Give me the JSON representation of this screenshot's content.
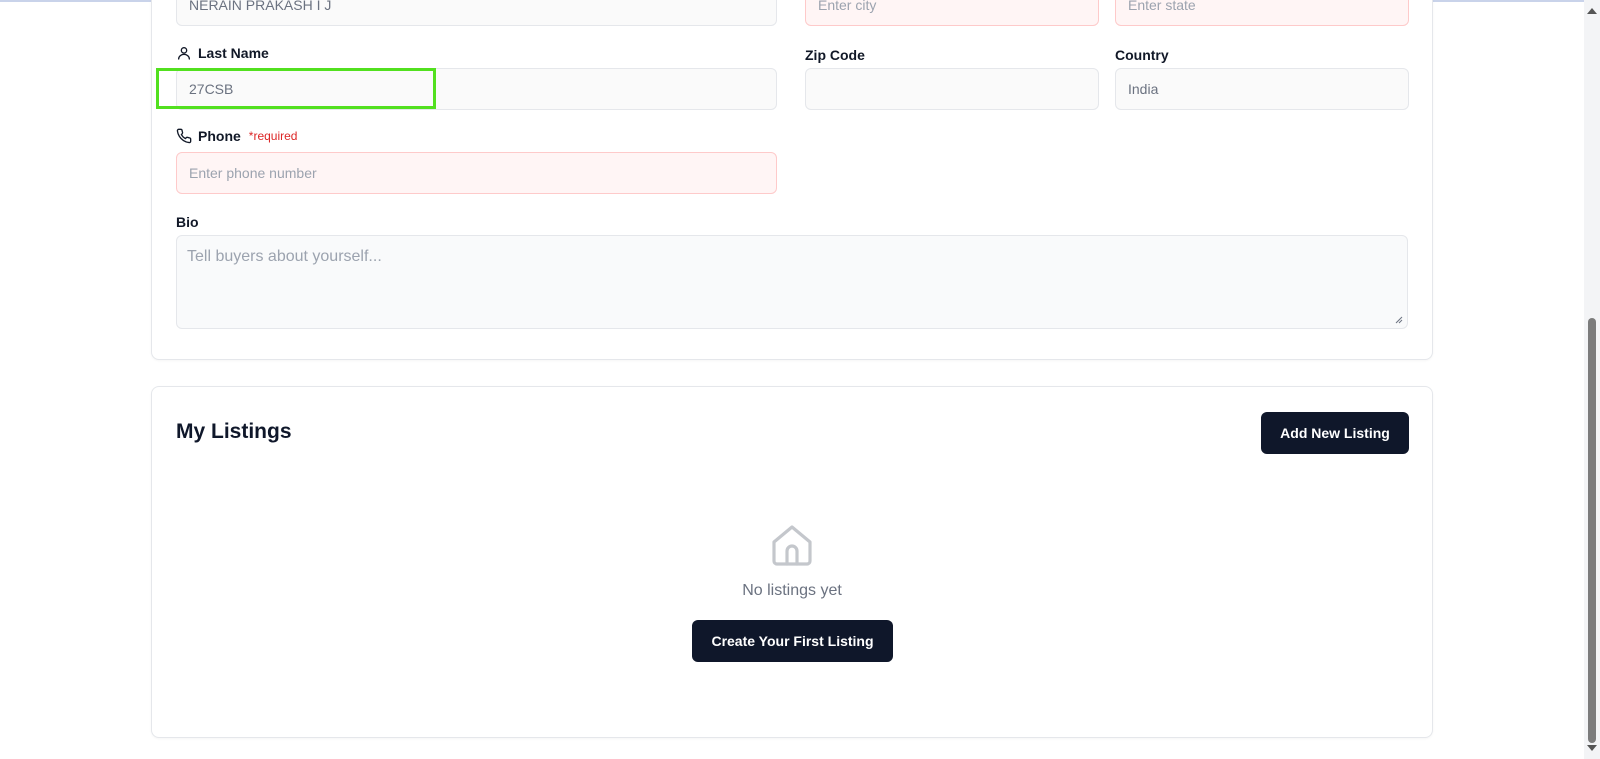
{
  "profile": {
    "first_name_value": "NERAIN PRAKASH I J",
    "city_placeholder": "Enter city",
    "state_placeholder": "Enter state",
    "last_name_label": "Last Name",
    "last_name_value": "27CSB",
    "zip_label": "Zip Code",
    "zip_value": "",
    "country_label": "Country",
    "country_value": "India",
    "phone_label": "Phone",
    "phone_required": "*required",
    "phone_placeholder": "Enter phone number",
    "bio_label": "Bio",
    "bio_placeholder": "Tell buyers about yourself..."
  },
  "listings": {
    "title": "My Listings",
    "add_button": "Add New Listing",
    "empty_text": "No listings yet",
    "create_button": "Create Your First Listing"
  },
  "icons": {
    "last_name": "user-icon",
    "phone": "phone-icon",
    "empty": "home-icon"
  },
  "colors": {
    "primary_button": "#0f172a",
    "required": "#dc2626",
    "highlight": "#52e01f",
    "error_bg": "#fff5f5"
  }
}
